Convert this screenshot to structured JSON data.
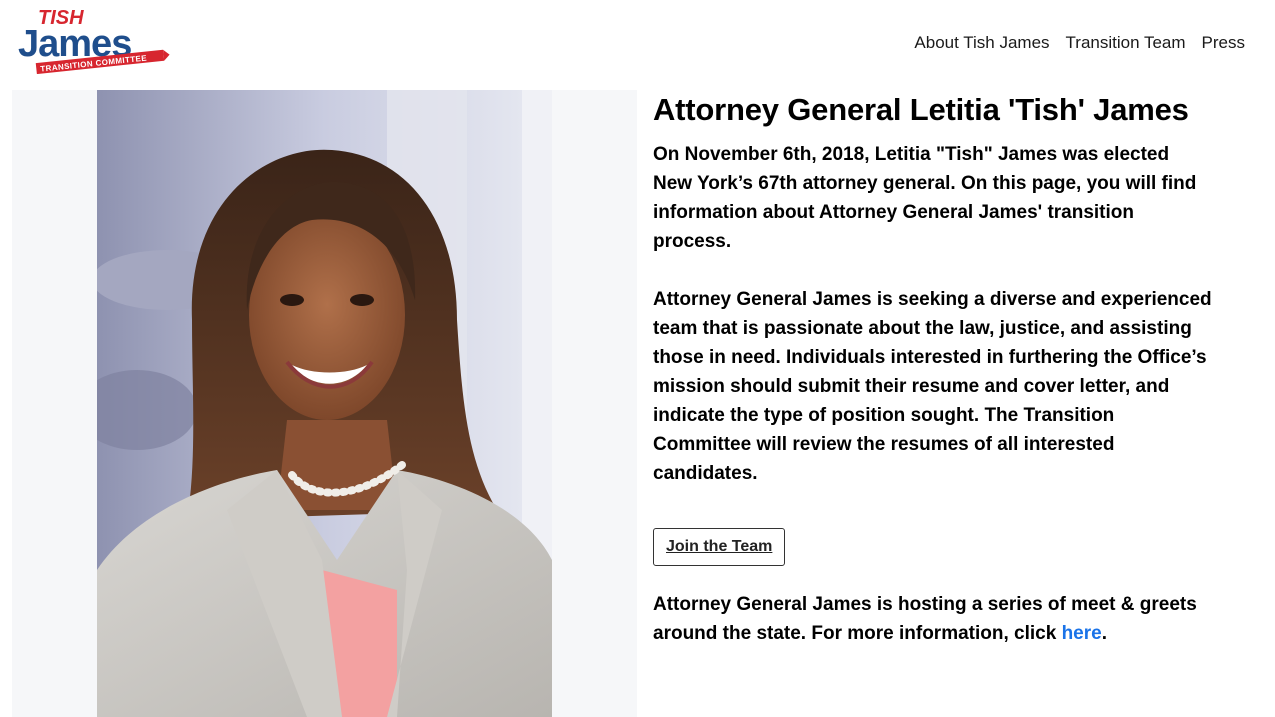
{
  "logo": {
    "top_text": "TISH",
    "main_text": "James",
    "ribbon_text": "TRANSITION COMMITTEE",
    "colors": {
      "red": "#d7262f",
      "blue": "#1f4e8c"
    }
  },
  "nav": {
    "items": [
      {
        "label": "About Tish James"
      },
      {
        "label": "Transition Team"
      },
      {
        "label": "Press"
      }
    ]
  },
  "photo": {
    "subject": "portrait-photo"
  },
  "main": {
    "title": "Attorney General Letitia 'Tish' James",
    "paragraph1": "On November 6th, 2018, Letitia \"Tish\" James was elected New York’s 67th attorney general. On this page, you will find information about Attorney General James' transition process.",
    "paragraph2": "Attorney General James is seeking a diverse and experienced team that is passionate about the law, justice, and assisting those in need. Individuals interested in furthering the Office’s mission should submit their resume and cover letter, and indicate the type of position sought. The Transition Committee will review the resumes of all interested candidates.",
    "button_label": "Join the Team",
    "paragraph3_prefix": "Attorney General James is hosting a series of meet & greets around the state. For more information, click ",
    "paragraph3_link": "here",
    "paragraph3_suffix": ".",
    "link_color": "#1a73e8"
  }
}
